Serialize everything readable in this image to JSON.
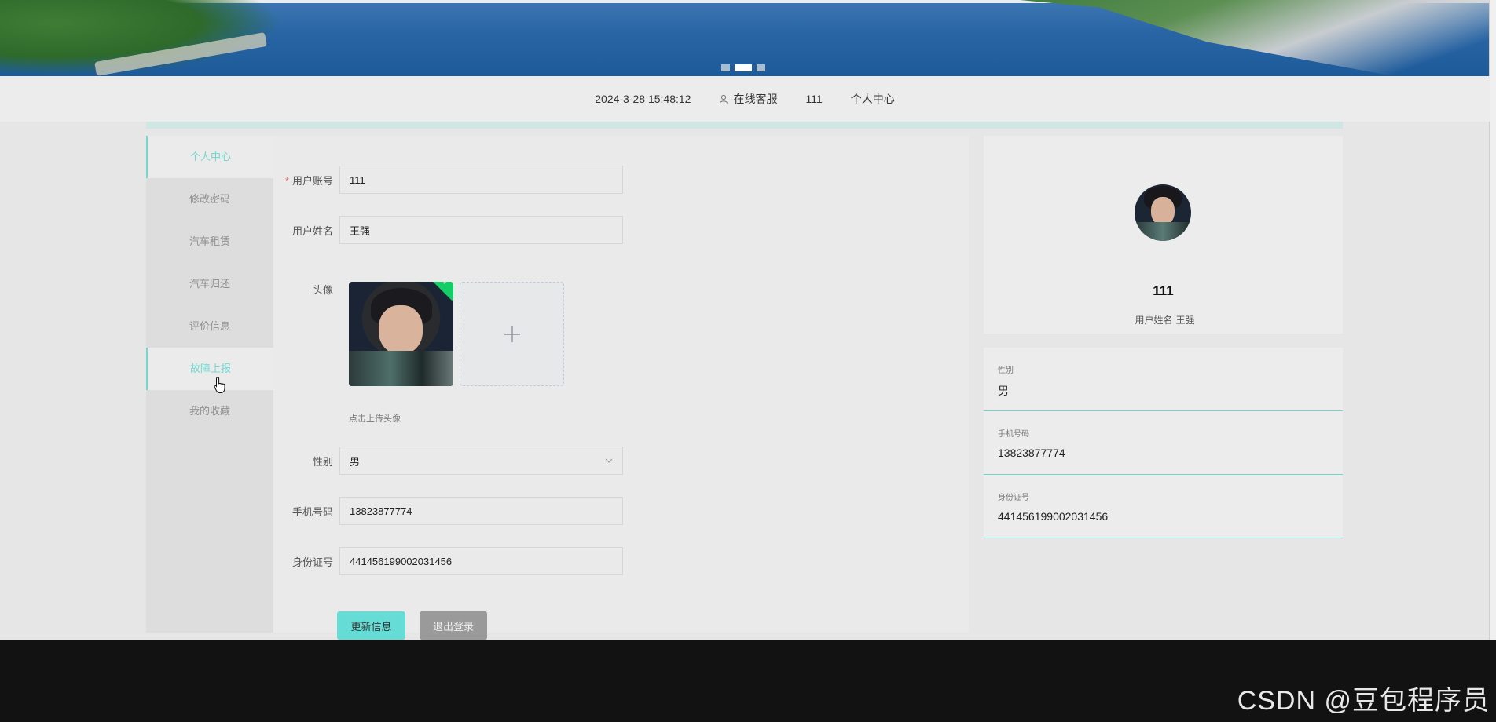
{
  "banner": {
    "active_slide": 2,
    "slide_count": 3
  },
  "nav": {
    "datetime": "2024-3-28 15:48:12",
    "service_label": "在线客服",
    "username": "111",
    "center_label": "个人中心"
  },
  "sidebar": {
    "items": [
      {
        "label": "个人中心"
      },
      {
        "label": "修改密码"
      },
      {
        "label": "汽车租赁"
      },
      {
        "label": "汽车归还"
      },
      {
        "label": "评价信息"
      },
      {
        "label": "故障上报"
      },
      {
        "label": "我的收藏"
      }
    ]
  },
  "form": {
    "account_label": "用户账号",
    "account_value": "111",
    "name_label": "用户姓名",
    "name_value": "王强",
    "avatar_label": "头像",
    "upload_hint": "点击上传头像",
    "gender_label": "性别",
    "gender_value": "男",
    "phone_label": "手机号码",
    "phone_value": "13823877774",
    "id_label": "身份证号",
    "id_value": "441456199002031456",
    "update_button": "更新信息",
    "logout_button": "退出登录"
  },
  "profile": {
    "name": "111",
    "sub_label": "用户姓名",
    "sub_value": "王强"
  },
  "info": {
    "gender_label": "性别",
    "gender_value": "男",
    "phone_label": "手机号码",
    "phone_value": "13823877774",
    "id_label": "身份证号",
    "id_value": "441456199002031456"
  },
  "watermark": "CSDN @豆包程序员",
  "colors": {
    "accent": "#6fd8cf",
    "primary_button": "#65ddd6",
    "gray_button": "#9a9a9a"
  }
}
